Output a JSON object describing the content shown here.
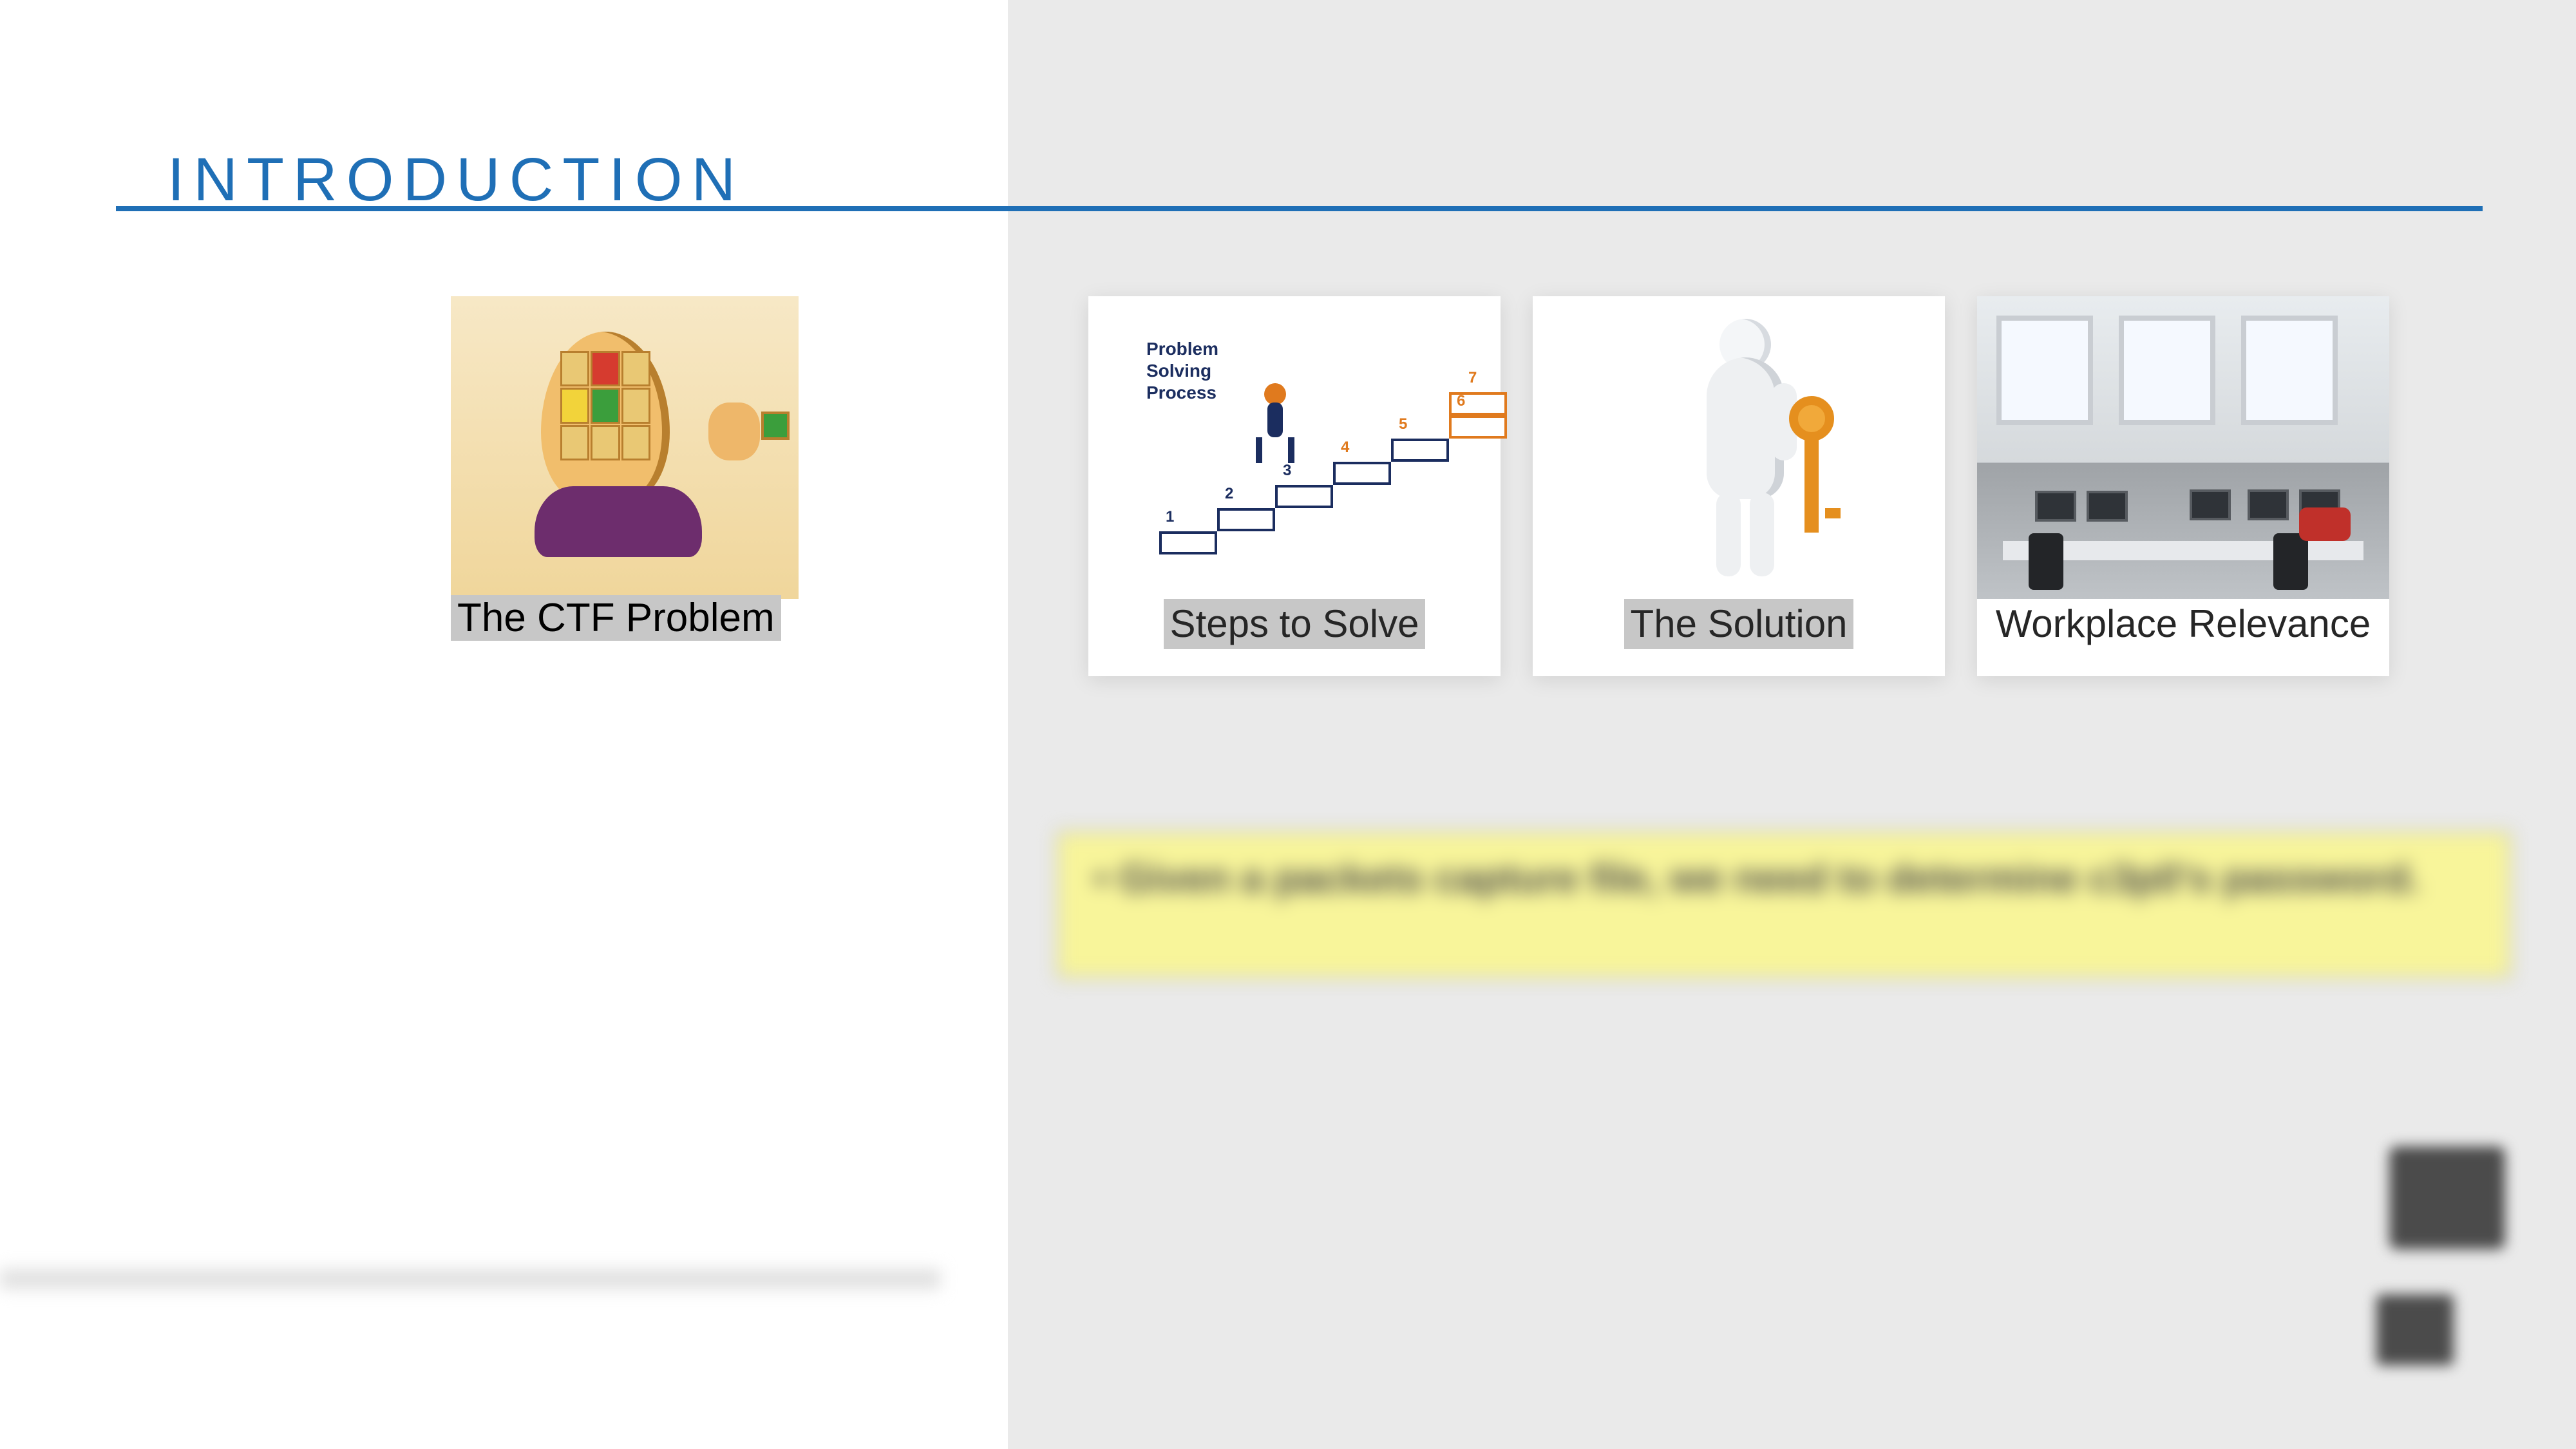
{
  "heading": "INTRODUCTION",
  "cards": [
    {
      "label": "The CTF Problem"
    },
    {
      "label": "Steps to Solve"
    },
    {
      "label": "The Solution"
    },
    {
      "label": "Workplace Relevance"
    }
  ],
  "steps_graphic": {
    "title": "Problem\nSolving\nProcess",
    "numbers": [
      "1",
      "2",
      "3",
      "4",
      "5",
      "6",
      "7"
    ]
  },
  "note": "Given a packets capture file, we need to determine c3p0's password."
}
